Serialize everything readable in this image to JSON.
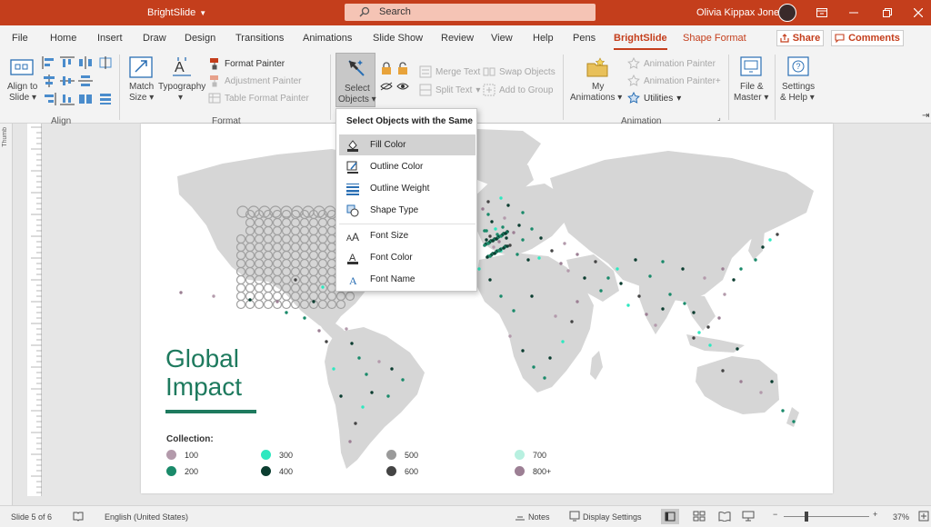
{
  "window": {
    "app_name": "BrightSlide",
    "search_label": "Search",
    "user_name": "Olivia Kippax Jones"
  },
  "menu": {
    "tabs": [
      "File",
      "Home",
      "Insert",
      "Draw",
      "Design",
      "Transitions",
      "Animations",
      "Slide Show",
      "Review",
      "View",
      "Help",
      "Pens",
      "BrightSlide",
      "Shape Format"
    ],
    "active_tab": "BrightSlide",
    "share_label": "Share",
    "comments_label": "Comments"
  },
  "ribbon": {
    "align_to_slide_line1": "Align to",
    "align_to_slide_line2": "Slide",
    "align_group": "Align",
    "match_size_line1": "Match",
    "match_size_line2": "Size",
    "typography": "Typography",
    "format_painter": "Format Painter",
    "adjustment_painter": "Adjustment Painter",
    "table_format_painter": "Table Format Painter",
    "format_group": "Format",
    "select_objects_line1": "Select",
    "select_objects_line2": "Objects",
    "merge_text": "Merge Text",
    "split_text": "Split Text",
    "swap_objects": "Swap Objects",
    "add_to_group": "Add to Group",
    "my_animations_line1": "My",
    "my_animations_line2": "Animations",
    "animation_painter": "Animation Painter",
    "animation_painter_plus": "Animation Painter+",
    "utilities": "Utilities",
    "animation_group": "Animation",
    "file_master_line1": "File &",
    "file_master_line2": "Master",
    "settings_help_line1": "Settings",
    "settings_help_line2": "& Help"
  },
  "dropdown": {
    "header": "Select Objects with the Same",
    "items": [
      {
        "label": "Fill Color",
        "icon": "fill-color-icon",
        "selected": true
      },
      {
        "label": "Outline Color",
        "icon": "outline-color-icon"
      },
      {
        "label": "Outline Weight",
        "icon": "outline-weight-icon"
      },
      {
        "label": "Shape Type",
        "icon": "shape-type-icon"
      },
      {
        "label": "Font Size",
        "icon": "font-size-icon"
      },
      {
        "label": "Font Color",
        "icon": "font-color-icon"
      },
      {
        "label": "Font Name",
        "icon": "font-name-icon"
      }
    ]
  },
  "thumbnails_label": "Thumb",
  "slide": {
    "title": "Global\nImpact",
    "collection_label": "Collection:",
    "legend": [
      {
        "label": "100",
        "color": "#b39aab"
      },
      {
        "label": "200",
        "color": "#1a8a6a"
      },
      {
        "label": "300",
        "color": "#2ee8c0"
      },
      {
        "label": "400",
        "color": "#0b3d30"
      },
      {
        "label": "500",
        "color": "#9a9a9a"
      },
      {
        "label": "600",
        "color": "#444444"
      },
      {
        "label": "700",
        "color": "#b8f0e0"
      },
      {
        "label": "800+",
        "color": "#9c7f94"
      }
    ]
  },
  "status": {
    "slide_info": "Slide 5 of 6",
    "language": "English (United States)",
    "notes": "Notes",
    "display_settings": "Display Settings",
    "zoom": "37%"
  },
  "colors": {
    "accent": "#c43e1c",
    "title_green": "#1e7a5e",
    "map_land": "#d6d6d6"
  }
}
